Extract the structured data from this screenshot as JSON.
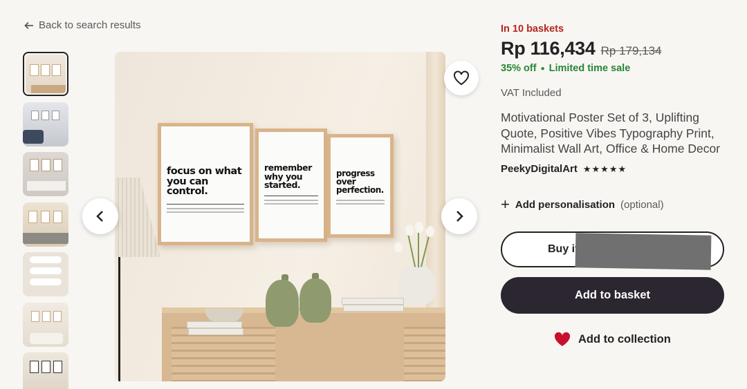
{
  "nav": {
    "back_label": "Back to search results"
  },
  "product": {
    "baskets": "In 10 baskets",
    "price": "Rp 116,434",
    "old_price": "Rp 179,134",
    "discount": "35% off",
    "sale_label": "Limited time sale",
    "vat": "VAT Included",
    "title": "Motivational Poster Set of 3, Uplifting Quote, Positive Vibes Typography Print, Minimalist Wall Art, Office & Home Decor",
    "shop": "PeekyDigitalArt",
    "rating_stars": 5
  },
  "options": {
    "personalise_label": "Add personalisation",
    "personalise_optional": "(optional)"
  },
  "actions": {
    "buy_label": "Buy it",
    "basket_label": "Add to basket",
    "collection_label": "Add to collection"
  },
  "image": {
    "posters": [
      "focus on what you can control.",
      "remember why you started.",
      "progress over perfection."
    ]
  },
  "thumbnails_count": 7,
  "colors": {
    "sale_red": "#b3261e",
    "sale_green": "#258635",
    "button_dark": "#2c2630",
    "heart_red": "#c8102e"
  }
}
